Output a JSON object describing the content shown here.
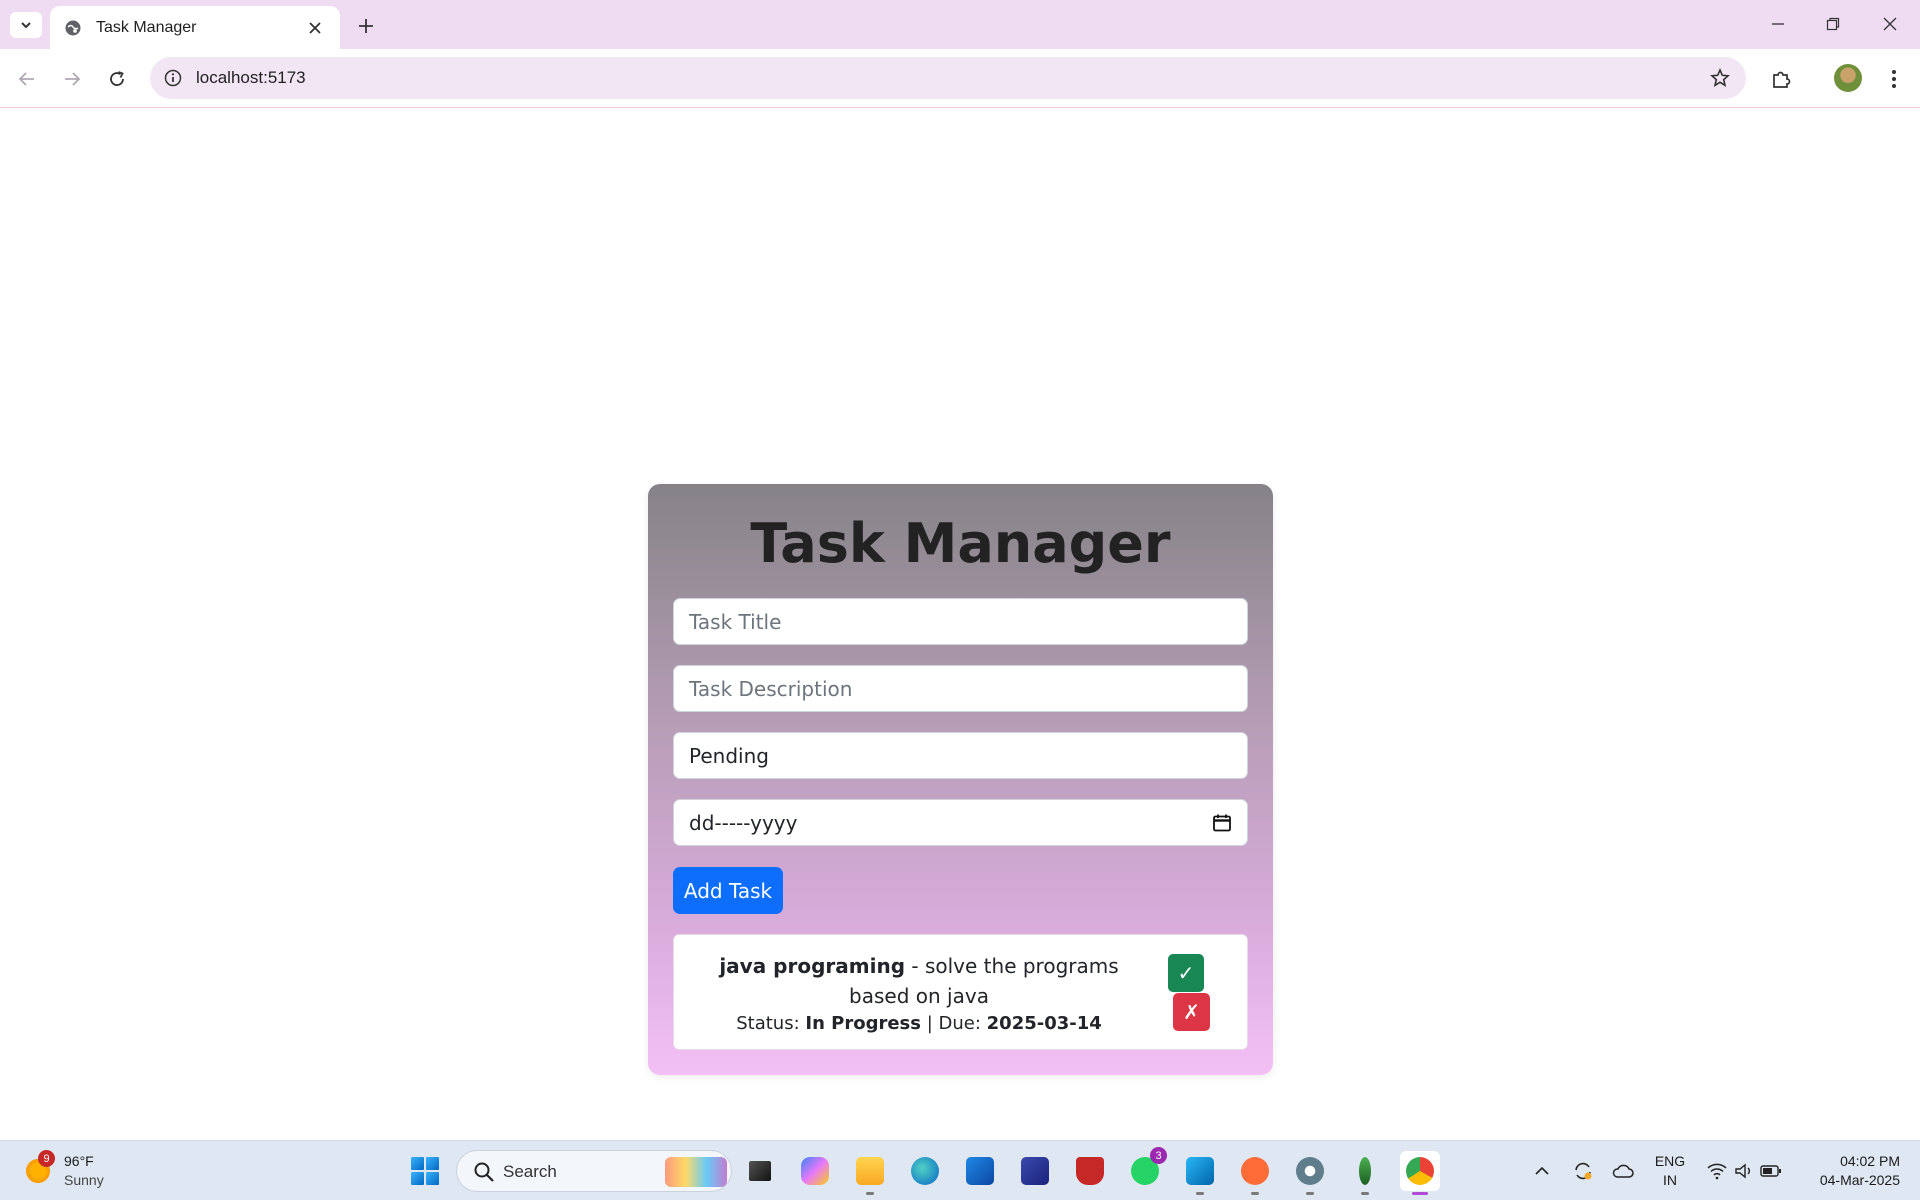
{
  "browser": {
    "tab_title": "Task Manager",
    "url": "localhost:5173",
    "icons": {
      "tab_list": "chevron-down-icon",
      "favicon": "globe-icon",
      "tab_close": "close-icon",
      "new_tab": "plus-icon",
      "back": "arrow-left-icon",
      "forward": "arrow-right-icon",
      "reload": "reload-icon",
      "site_info": "info-icon",
      "bookmark": "star-icon",
      "extensions": "puzzle-icon",
      "menu": "more-vertical-icon"
    }
  },
  "app": {
    "title": "Task Manager",
    "form": {
      "title_placeholder": "Task Title",
      "description_placeholder": "Task Description",
      "status_value": "Pending",
      "date_value": "dd-----yyyy",
      "add_label": "Add Task"
    },
    "tasks": [
      {
        "title": "java programing",
        "separator": " - ",
        "description": "solve the programs based on java",
        "status_label": "Status: ",
        "status": "In Progress",
        "due_label": " | Due: ",
        "due": "2025-03-14",
        "done_label": "✓",
        "delete_label": "✗"
      }
    ],
    "colors": {
      "primary": "#0d6efd",
      "success": "#198754",
      "danger": "#dc3545"
    }
  },
  "taskbar": {
    "weather": {
      "temp": "96°F",
      "desc": "Sunny",
      "badge": "9"
    },
    "search_label": "Search",
    "whatsapp_badge": "3",
    "lang_top": "ENG",
    "lang_bottom": "IN",
    "time": "04:02 PM",
    "date": "04-Mar-2025"
  }
}
